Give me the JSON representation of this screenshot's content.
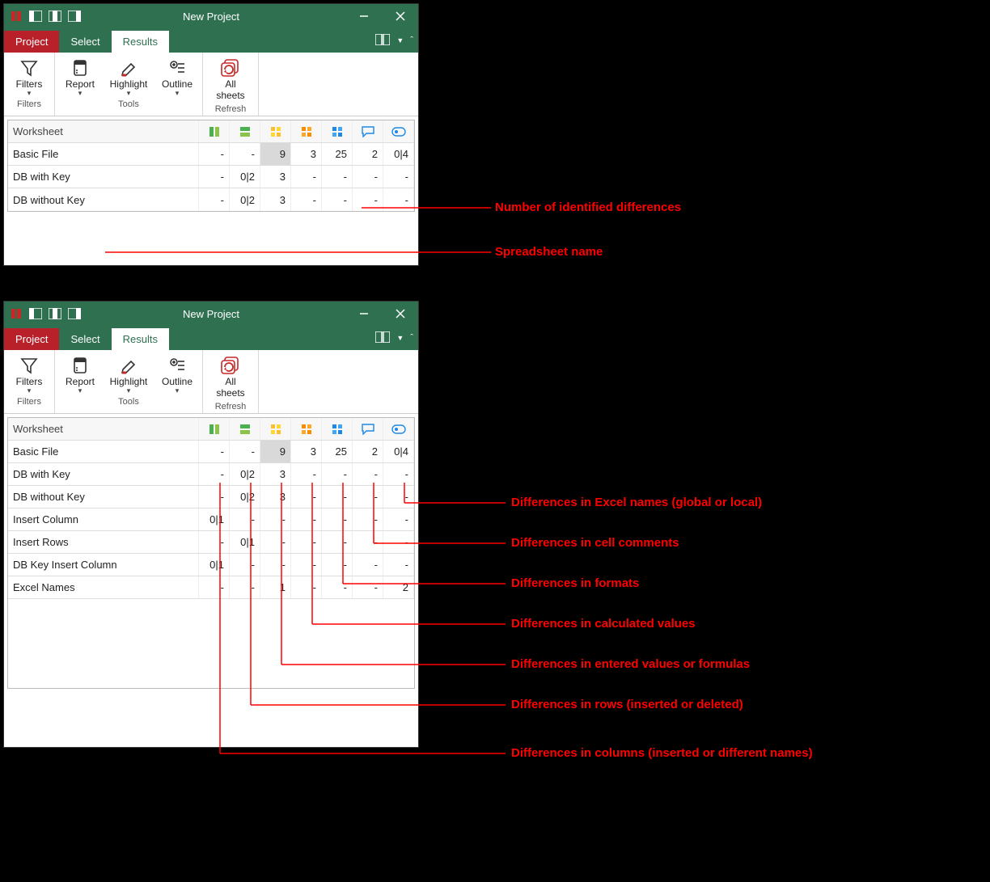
{
  "window": {
    "title": "New Project",
    "tabs": {
      "project": "Project",
      "select": "Select",
      "results": "Results"
    },
    "ribbon": {
      "filters": {
        "label": "Filters",
        "group": "Filters"
      },
      "report": "Report",
      "highlight": "Highlight",
      "outline": "Outline",
      "tools_group": "Tools",
      "allsheets": "All\nsheets",
      "refresh_group": "Refresh"
    },
    "grid": {
      "header_name": "Worksheet",
      "col_icons": [
        "columns-icon",
        "rows-icon",
        "entered-icon",
        "calc-icon",
        "format-icon",
        "comment-icon",
        "names-icon"
      ]
    }
  },
  "top_rows": [
    {
      "name": "Basic File",
      "c": [
        "-",
        "-",
        "9",
        "3",
        "25",
        "2",
        "0|4"
      ]
    },
    {
      "name": "DB with Key",
      "c": [
        "-",
        "0|2",
        "3",
        "-",
        "-",
        "-",
        "-"
      ]
    },
    {
      "name": "DB without Key",
      "c": [
        "-",
        "0|2",
        "3",
        "-",
        "-",
        "-",
        "-"
      ]
    }
  ],
  "bottom_rows": [
    {
      "name": "Basic File",
      "c": [
        "-",
        "-",
        "9",
        "3",
        "25",
        "2",
        "0|4"
      ]
    },
    {
      "name": "DB with Key",
      "c": [
        "-",
        "0|2",
        "3",
        "-",
        "-",
        "-",
        "-"
      ]
    },
    {
      "name": "DB without Key",
      "c": [
        "-",
        "0|2",
        "3",
        "-",
        "-",
        "-",
        "-"
      ]
    },
    {
      "name": "Insert Column",
      "c": [
        "0|1",
        "-",
        "-",
        "-",
        "-",
        "-",
        "-"
      ]
    },
    {
      "name": "Insert Rows",
      "c": [
        "-",
        "0|1",
        "-",
        "-",
        "-",
        "-",
        "-"
      ]
    },
    {
      "name": "DB Key Insert Column",
      "c": [
        "0|1",
        "-",
        "-",
        "-",
        "-",
        "-",
        "-"
      ]
    },
    {
      "name": "Excel Names",
      "c": [
        "-",
        "-",
        "1",
        "-",
        "-",
        "-",
        "2"
      ]
    }
  ],
  "annotations": {
    "top1": "Number of identified differences",
    "top2": "Spreadsheet name",
    "b_names": "Differences in Excel names (global or local)",
    "b_comment": "Differences in cell comments",
    "b_format": "Differences in formats",
    "b_calc": "Differences in calculated values",
    "b_entered": "Differences in entered values or formulas",
    "b_rows": "Differences in rows (inserted or deleted)",
    "b_cols": "Differences in columns (inserted or different names)"
  }
}
